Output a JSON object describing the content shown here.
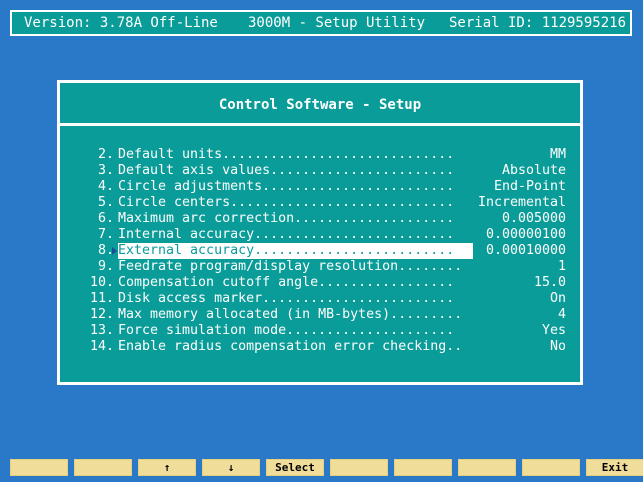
{
  "title_bar": {
    "version": "Version: 3.78A Off-Line",
    "app_title": "3000M - Setup Utility",
    "serial": "Serial ID: 1129595216"
  },
  "dialog": {
    "title": "Control Software - Setup",
    "selected_index": 6,
    "items": [
      {
        "num": "2.",
        "label": "Default units.............................",
        "value": "MM"
      },
      {
        "num": "3.",
        "label": "Default axis values.......................",
        "value": "Absolute"
      },
      {
        "num": "4.",
        "label": "Circle adjustments........................",
        "value": "End-Point"
      },
      {
        "num": "5.",
        "label": "Circle centers............................",
        "value": "Incremental"
      },
      {
        "num": "6.",
        "label": "Maximum arc correction....................",
        "value": "0.005000"
      },
      {
        "num": "7.",
        "label": "Internal accuracy.........................",
        "value": "0.00000100"
      },
      {
        "num": "8.",
        "label": "External accuracy.........................",
        "value": "0.00010000"
      },
      {
        "num": "9.",
        "label": "Feedrate program/display resolution........",
        "value": "1"
      },
      {
        "num": "10.",
        "label": "Compensation cutoff angle.................",
        "value": "15.0"
      },
      {
        "num": "11.",
        "label": "Disk access marker........................",
        "value": "On"
      },
      {
        "num": "12.",
        "label": "Max memory allocated (in MB-bytes).........",
        "value": "4"
      },
      {
        "num": "13.",
        "label": "Force simulation mode.....................",
        "value": "Yes"
      },
      {
        "num": "14.",
        "label": "Enable radius compensation error checking..",
        "value": "No"
      }
    ]
  },
  "function_keys": [
    "",
    "",
    "↑",
    "↓",
    "Select",
    "",
    "",
    "",
    "",
    "Exit"
  ],
  "colors": {
    "background": "#2a79c8",
    "panel": "#0a9c98",
    "text": "#ffffff",
    "fkey": "#f1dd9a"
  }
}
